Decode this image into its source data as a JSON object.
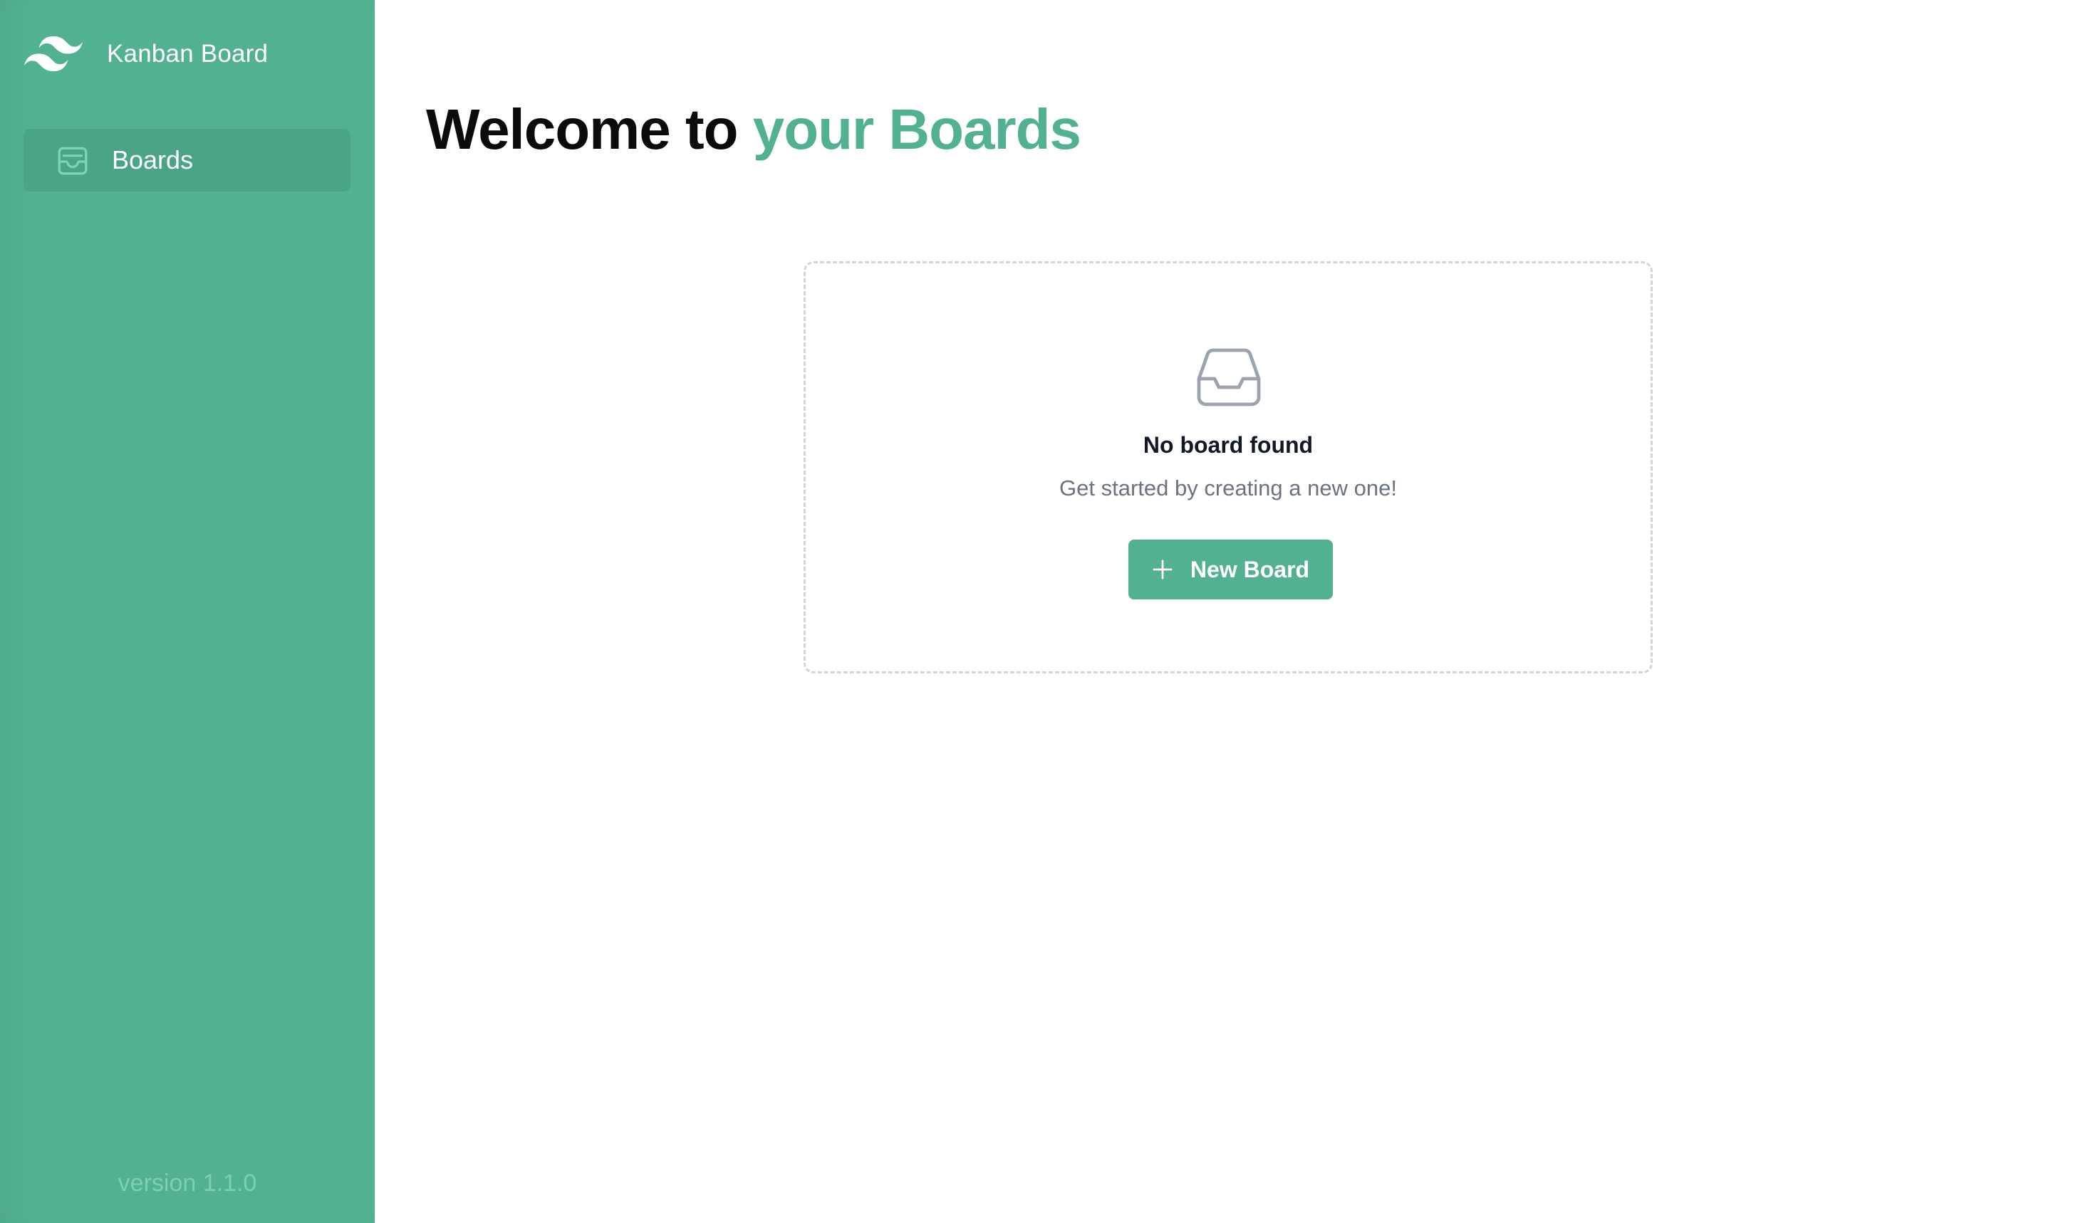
{
  "app": {
    "title": "Kanban Board",
    "logo_icon": "tailwind-wave-icon",
    "version_label": "version 1.1.0"
  },
  "sidebar": {
    "items": [
      {
        "label": "Boards",
        "icon": "inbox-icon",
        "active": true
      }
    ]
  },
  "main": {
    "title_part1": "Welcome to",
    "title_part2": "your Boards",
    "empty_state": {
      "icon": "inbox-icon",
      "title": "No board found",
      "subtitle": "Get started by creating a new one!",
      "button_label": "New Board",
      "button_icon": "plus-icon"
    }
  },
  "colors": {
    "brand": "#52b28f",
    "sidebar_active": "#4aa584",
    "version_text": "#7dcfb1",
    "heading": "#0b0b0b",
    "muted_text": "#6b7280",
    "dashed_border": "#d1d5db"
  }
}
